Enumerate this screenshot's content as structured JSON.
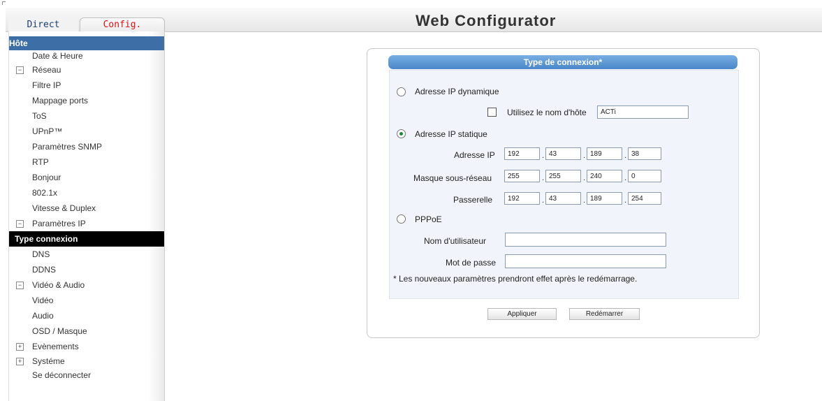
{
  "app": {
    "title": "Web Configurator"
  },
  "tabs": {
    "direct": "Direct",
    "config": "Config."
  },
  "sidebar": {
    "items": [
      {
        "label": "Hôte",
        "toggle": ""
      },
      {
        "label": "Date & Heure",
        "toggle": ""
      },
      {
        "label": "Réseau",
        "toggle": "−"
      },
      {
        "label": "Filtre IP",
        "toggle": ""
      },
      {
        "label": "Mappage ports",
        "toggle": ""
      },
      {
        "label": "ToS",
        "toggle": ""
      },
      {
        "label": "UPnP™",
        "toggle": ""
      },
      {
        "label": "Paramètres SNMP",
        "toggle": ""
      },
      {
        "label": "RTP",
        "toggle": ""
      },
      {
        "label": "Bonjour",
        "toggle": ""
      },
      {
        "label": "802.1x",
        "toggle": ""
      },
      {
        "label": "Vitesse & Duplex",
        "toggle": ""
      },
      {
        "label": "Paramètres IP",
        "toggle": "−"
      },
      {
        "label": "Type connexion",
        "toggle": ""
      },
      {
        "label": "DNS",
        "toggle": ""
      },
      {
        "label": "DDNS",
        "toggle": ""
      },
      {
        "label": "Vidéo & Audio",
        "toggle": "−"
      },
      {
        "label": "Vidéo",
        "toggle": ""
      },
      {
        "label": "Audio",
        "toggle": ""
      },
      {
        "label": "OSD / Masque",
        "toggle": ""
      },
      {
        "label": "Evènements",
        "toggle": "+"
      },
      {
        "label": "Systéme",
        "toggle": "+"
      },
      {
        "label": "Se déconnecter",
        "toggle": ""
      }
    ]
  },
  "form": {
    "title": "Type de connexion*",
    "dynamic_label": "Adresse IP dynamique",
    "hostname_label": "Utilisez le nom d'hôte",
    "hostname_value": "ACTi",
    "static_label": "Adresse IP statique",
    "ip_label": "Adresse IP",
    "ip": [
      "192",
      "43",
      "189",
      "38"
    ],
    "mask_label": "Masque sous-réseau",
    "mask": [
      "255",
      "255",
      "240",
      "0"
    ],
    "gateway_label": "Passerelle",
    "gateway": [
      "192",
      "43",
      "189",
      "254"
    ],
    "pppoe_label": "PPPoE",
    "user_label": "Nom d'utilisateur",
    "user_value": "",
    "password_label": "Mot de passe",
    "password_value": "",
    "note": "* Les nouveaux paramètres prendront effet après le redémarrage.",
    "selected": "static"
  },
  "buttons": {
    "apply": "Appliquer",
    "restart": "Redémarrer"
  }
}
